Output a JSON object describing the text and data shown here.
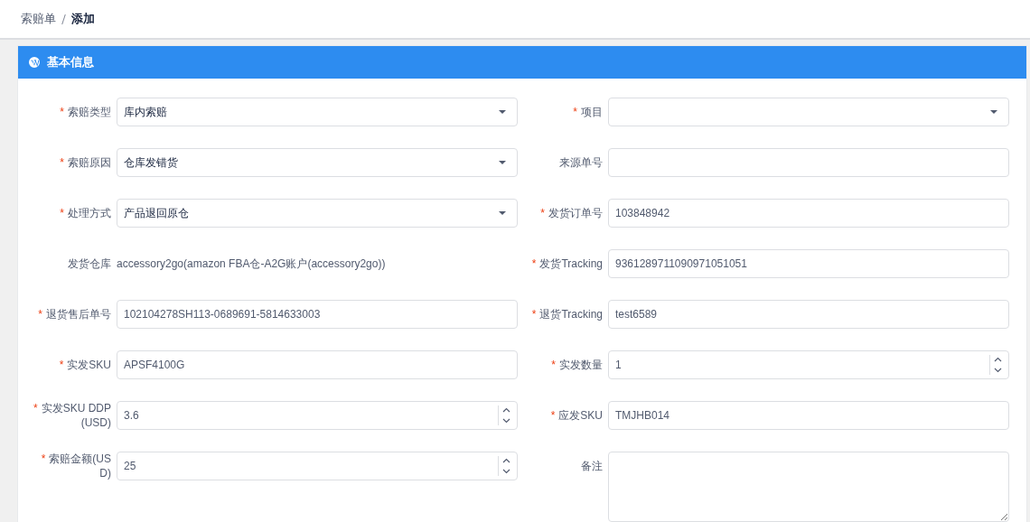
{
  "breadcrumb": [
    {
      "label": "索赔单",
      "current": false
    },
    {
      "label": "添加",
      "current": true
    }
  ],
  "panel": {
    "title": "基本信息"
  },
  "fields": [
    {
      "required_mark": "*",
      "label": "索赔类型",
      "kind": "select",
      "value": "库内索赔"
    },
    {
      "required_mark": "*",
      "label": "项目",
      "kind": "select"
    },
    {
      "required_mark": "*",
      "label": "索赔原因",
      "kind": "select",
      "value": "仓库发错货"
    },
    {
      "label": "来源单号",
      "kind": "text"
    },
    {
      "required_mark": "*",
      "label": "处理方式",
      "kind": "select",
      "value": "产品退回原仓"
    },
    {
      "required_mark": "*",
      "label": "发货订单号",
      "kind": "text",
      "value": "103848942"
    },
    {
      "label": "发货仓库",
      "kind": "static",
      "value": "accessory2go(amazon FBA仓-A2G账户(accessory2go))"
    },
    {
      "required_mark": "*",
      "label": "发货Tracking",
      "kind": "text",
      "value": "9361289711090971051051"
    },
    {
      "required_mark": "*",
      "label": "退货售后单号",
      "kind": "text",
      "value": "102104278SH113-0689691-5814633003"
    },
    {
      "required_mark": "*",
      "label": "退货Tracking",
      "kind": "text",
      "value": "test6589"
    },
    {
      "required_mark": "*",
      "label": "实发SKU",
      "kind": "text",
      "value": "APSF4100G"
    },
    {
      "required_mark": "*",
      "label": "实发数量",
      "kind": "number",
      "value": "1"
    },
    {
      "required_mark": "*",
      "label": "实发SKU DDP (USD)",
      "kind": "number",
      "value": "3.6"
    },
    {
      "required_mark": "*",
      "label": "应发SKU",
      "kind": "text",
      "value": "TMJHB014"
    },
    {
      "required_mark": "*",
      "label": "索赔金额(USD)",
      "kind": "number",
      "value": "25"
    },
    {
      "label": "备注",
      "kind": "textarea"
    }
  ]
}
